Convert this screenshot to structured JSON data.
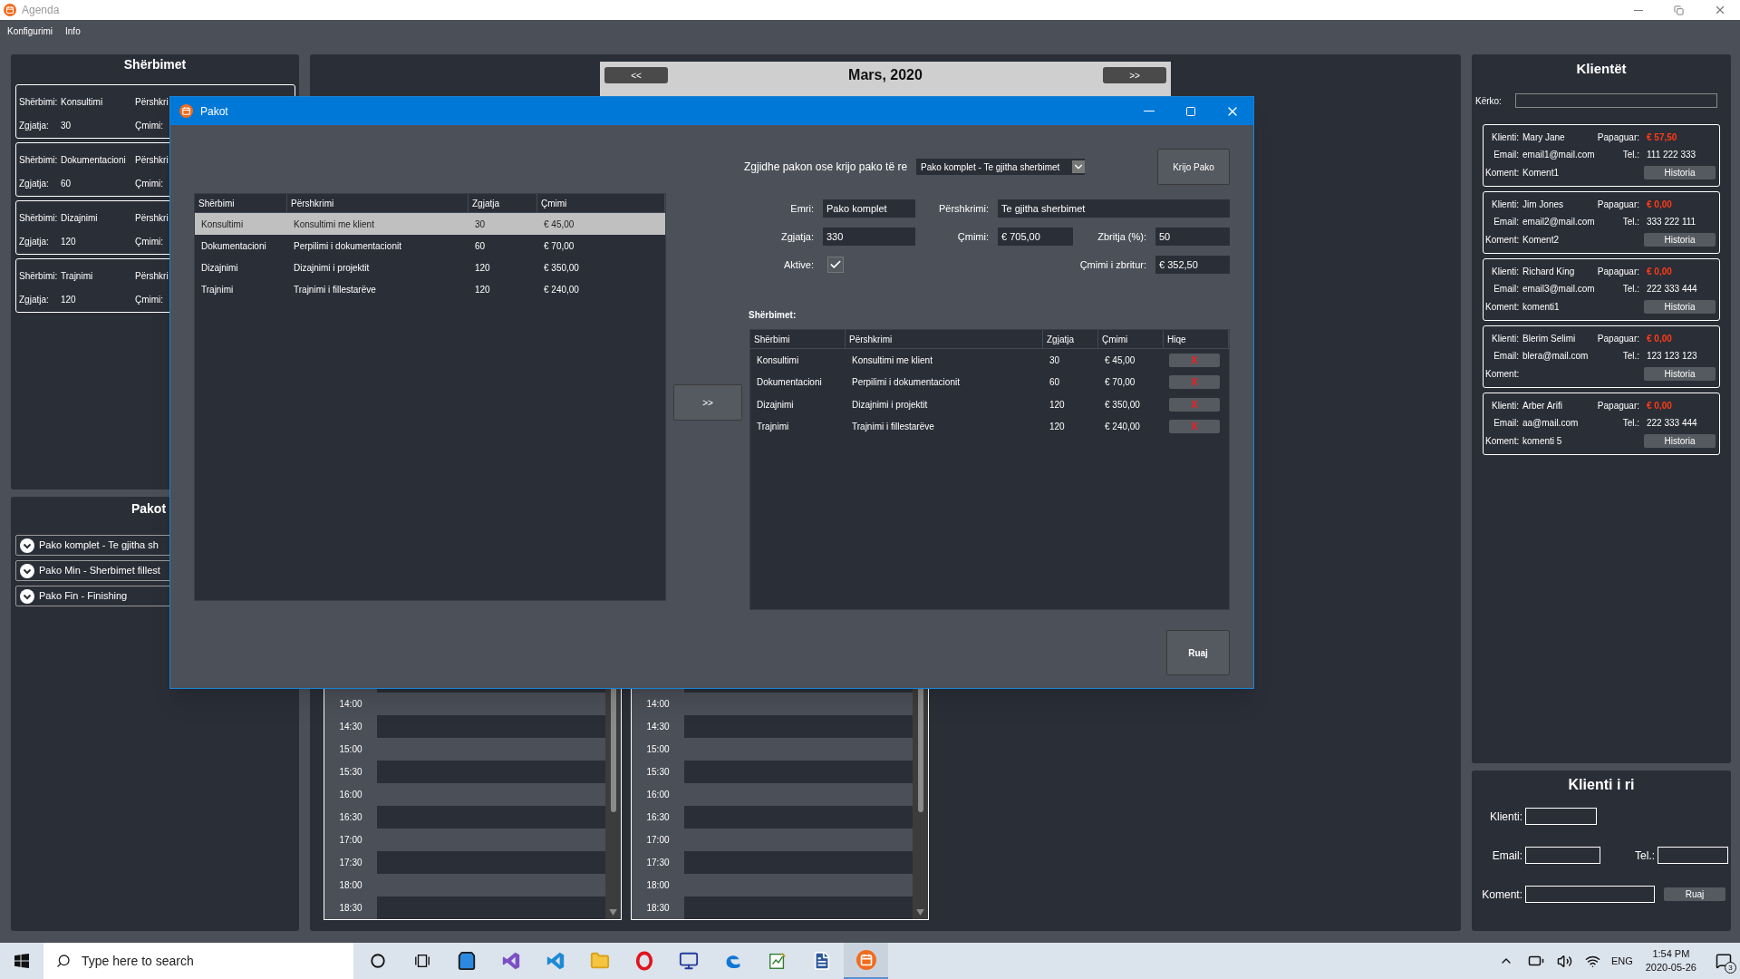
{
  "app_window": {
    "title": "Agenda"
  },
  "menu": [
    {
      "label": "Konfigurimi"
    },
    {
      "label": "Info"
    }
  ],
  "services_panel": {
    "title": "Shërbimet",
    "cards": [
      {
        "service_label": "Shërbimi:",
        "service": "Konsultimi",
        "description_label": "Përshkri",
        "duration_label": "Zgjatja:",
        "duration": "30",
        "price_label": "Çmimi:"
      },
      {
        "service_label": "Shërbimi:",
        "service": "Dokumentacioni",
        "description_label": "Përshkri",
        "duration_label": "Zgjatja:",
        "duration": "60",
        "price_label": "Çmimi:"
      },
      {
        "service_label": "Shërbimi:",
        "service": "Dizajnimi",
        "description_label": "Përshkri",
        "duration_label": "Zgjatja:",
        "duration": "120",
        "price_label": "Çmimi:"
      },
      {
        "service_label": "Shërbimi:",
        "service": "Trajnimi",
        "description_label": "Përshkri",
        "duration_label": "Zgjatja:",
        "duration": "120",
        "price_label": "Çmimi:"
      }
    ]
  },
  "packages_panel": {
    "title": "Pakot",
    "items": [
      {
        "label": "Pako komplet - Te gjitha sh"
      },
      {
        "label": "Pako Min - Sherbimet fillest"
      },
      {
        "label": "Pako Fin - Finishing"
      }
    ]
  },
  "calendar": {
    "prev_button": "<<",
    "month": "Mars, 2020",
    "next_button": ">>",
    "columns": [
      {
        "times": [
          "14:00",
          "14:30",
          "15:00",
          "15:30",
          "16:00",
          "16:30",
          "17:00",
          "17:30",
          "18:00",
          "18:30"
        ]
      },
      {
        "times": [
          "14:00",
          "14:30",
          "15:00",
          "15:30",
          "16:00",
          "16:30",
          "17:00",
          "17:30",
          "18:00",
          "18:30"
        ]
      }
    ]
  },
  "clients_panel": {
    "title": "Klientët",
    "search_label": "Kërko:",
    "clients": [
      {
        "name_label": "Klienti:",
        "name": "Mary Jane",
        "unpaid_label": "Papaguar:",
        "unpaid": "€ 57,50",
        "email_label": "Email:",
        "email": "email1@mail.com",
        "tel_label": "Tel.:",
        "tel": "111 222 333",
        "comment_label": "Koment:",
        "comment": "Koment1",
        "button": "Historia"
      },
      {
        "name_label": "Klienti:",
        "name": "Jim Jones",
        "unpaid_label": "Papaguar:",
        "unpaid": "€ 0,00",
        "email_label": "Email:",
        "email": "email2@mail.com",
        "tel_label": "Tel.:",
        "tel": "333 222 111",
        "comment_label": "Koment:",
        "comment": "Koment2",
        "button": "Historia"
      },
      {
        "name_label": "Klienti:",
        "name": "Richard King",
        "unpaid_label": "Papaguar:",
        "unpaid": "€ 0,00",
        "email_label": "Email:",
        "email": "email3@mail.com",
        "tel_label": "Tel.:",
        "tel": "222 333 444",
        "comment_label": "Koment:",
        "comment": "komenti1",
        "button": "Historia"
      },
      {
        "name_label": "Klienti:",
        "name": "Blerim Selimi",
        "unpaid_label": "Papaguar:",
        "unpaid": "€ 0,00",
        "email_label": "Email:",
        "email": "blera@mail.com",
        "tel_label": "Tel.:",
        "tel": "123 123 123",
        "comment_label": "Koment:",
        "button": "Historia"
      },
      {
        "name_label": "Klienti:",
        "name": "Arber Arifi",
        "unpaid_label": "Papaguar:",
        "unpaid": "€ 0,00",
        "email_label": "Email:",
        "email": "aa@mail.com",
        "tel_label": "Tel.:",
        "tel": "222 333 444",
        "comment_label": "Koment:",
        "comment": "komenti 5",
        "button": "Historia"
      }
    ]
  },
  "new_client": {
    "title": "Klienti i ri",
    "name_label": "Klienti:",
    "email_label": "Email:",
    "tel_label": "Tel.:",
    "comment_label": "Koment:",
    "save_button": "Ruaj"
  },
  "dialog": {
    "title": "Pakot",
    "available_table": {
      "columns": [
        "Shërbimi",
        "Përshkrimi",
        "Zgjatja",
        "Çmimi"
      ],
      "rows": [
        {
          "cells": [
            "Konsultimi",
            "Konsultimi me klient",
            "30",
            "€ 45,00"
          ],
          "selected": true
        },
        {
          "cells": [
            "Dokumentacioni",
            "Perpilimi i dokumentacionit",
            "60",
            "€ 70,00"
          ],
          "selected": false
        },
        {
          "cells": [
            "Dizajnimi",
            "Dizajnimi i projektit",
            "120",
            "€ 350,00"
          ],
          "selected": false
        },
        {
          "cells": [
            "Trajnimi",
            "Trajnimi i fillestarëve",
            "120",
            "€ 240,00"
          ],
          "selected": false
        }
      ]
    },
    "add_button": ">>",
    "picker": {
      "label": "Zgjidhe pakon ose krijo pako të re",
      "value": "Pako komplet - Te gjitha sherbimet"
    },
    "create_button": "Krijo Pako",
    "form": {
      "name_label": "Emri:",
      "name": "Pako komplet",
      "description_label": "Përshkrimi:",
      "description": "Te gjitha sherbimet",
      "duration_label": "Zgjatja:",
      "duration": "330",
      "price_label": "Çmimi:",
      "price": "€ 705,00",
      "discount_label": "Zbritja (%):",
      "discount": "50",
      "active_label": "Aktive:",
      "active": true,
      "discounted_label": "Çmimi i zbritur:",
      "discounted": "€ 352,50"
    },
    "services_label": "Shërbimet:",
    "services_table": {
      "columns": [
        "Shërbimi",
        "Përshkrimi",
        "Zgjatja",
        "Çmimi",
        "Hiqe"
      ],
      "rows": [
        {
          "cells": [
            "Konsultimi",
            "Konsultimi me klient",
            "30",
            "€ 45,00"
          ],
          "remove": "X"
        },
        {
          "cells": [
            "Dokumentacioni",
            "Perpilimi i dokumentacionit",
            "60",
            "€ 70,00"
          ],
          "remove": "X"
        },
        {
          "cells": [
            "Dizajnimi",
            "Dizajnimi i projektit",
            "120",
            "€ 350,00"
          ],
          "remove": "X"
        },
        {
          "cells": [
            "Trajnimi",
            "Trajnimi i fillestarëve",
            "120",
            "€ 240,00"
          ],
          "remove": "X"
        }
      ]
    },
    "save_button": "Ruaj"
  },
  "taskbar": {
    "search_placeholder": "Type here to search",
    "apps": [
      {
        "kind": "cortana",
        "active": false
      },
      {
        "kind": "taskview",
        "active": false
      },
      {
        "kind": "store",
        "active": false
      },
      {
        "kind": "studio",
        "active": false
      },
      {
        "kind": "code",
        "active": false
      },
      {
        "kind": "explorer",
        "active": false
      },
      {
        "kind": "opera",
        "active": false
      },
      {
        "kind": "monitor",
        "active": false
      },
      {
        "kind": "edge",
        "active": false
      },
      {
        "kind": "notepad",
        "active": false
      },
      {
        "kind": "word",
        "active": false
      },
      {
        "kind": "agenda",
        "active": true
      }
    ],
    "language": "ENG",
    "time": "1:54 PM",
    "date": "2020-05-26",
    "notifications": "3"
  }
}
